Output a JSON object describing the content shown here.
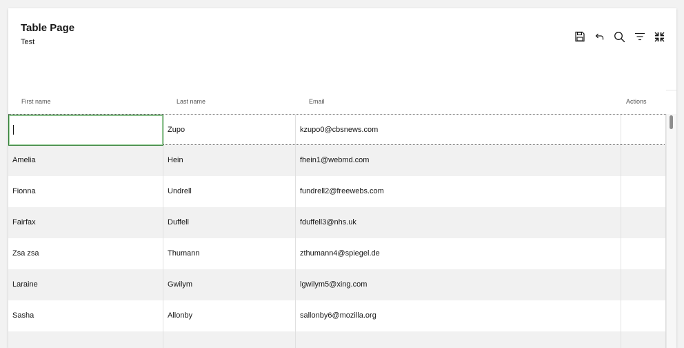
{
  "header": {
    "title": "Table Page",
    "subtitle": "Test"
  },
  "toolbar": {
    "icons": [
      "save-icon",
      "undo-icon",
      "search-icon",
      "filter-icon",
      "collapse-icon"
    ]
  },
  "table": {
    "columns": {
      "first_name": "First name",
      "last_name": "Last name",
      "email": "Email",
      "actions": "Actions"
    },
    "rows": [
      {
        "first": "",
        "last": "Zupo",
        "email": "kzupo0@cbsnews.com"
      },
      {
        "first": "Amelia",
        "last": "Hein",
        "email": "fhein1@webmd.com"
      },
      {
        "first": "Fionna",
        "last": "Undrell",
        "email": "fundrell2@freewebs.com"
      },
      {
        "first": "Fairfax",
        "last": "Duffell",
        "email": "fduffell3@nhs.uk"
      },
      {
        "first": "Zsa zsa",
        "last": "Thumann",
        "email": "zthumann4@spiegel.de"
      },
      {
        "first": "Laraine",
        "last": "Gwilym",
        "email": "lgwilym5@xing.com"
      },
      {
        "first": "Sasha",
        "last": "Allonby",
        "email": "sallonby6@mozilla.org"
      },
      {
        "first": "",
        "last": "",
        "email": ""
      }
    ]
  },
  "colors": {
    "stripe": "#f1f1f1",
    "edit_border": "#2e7d32",
    "text": "#161616"
  }
}
